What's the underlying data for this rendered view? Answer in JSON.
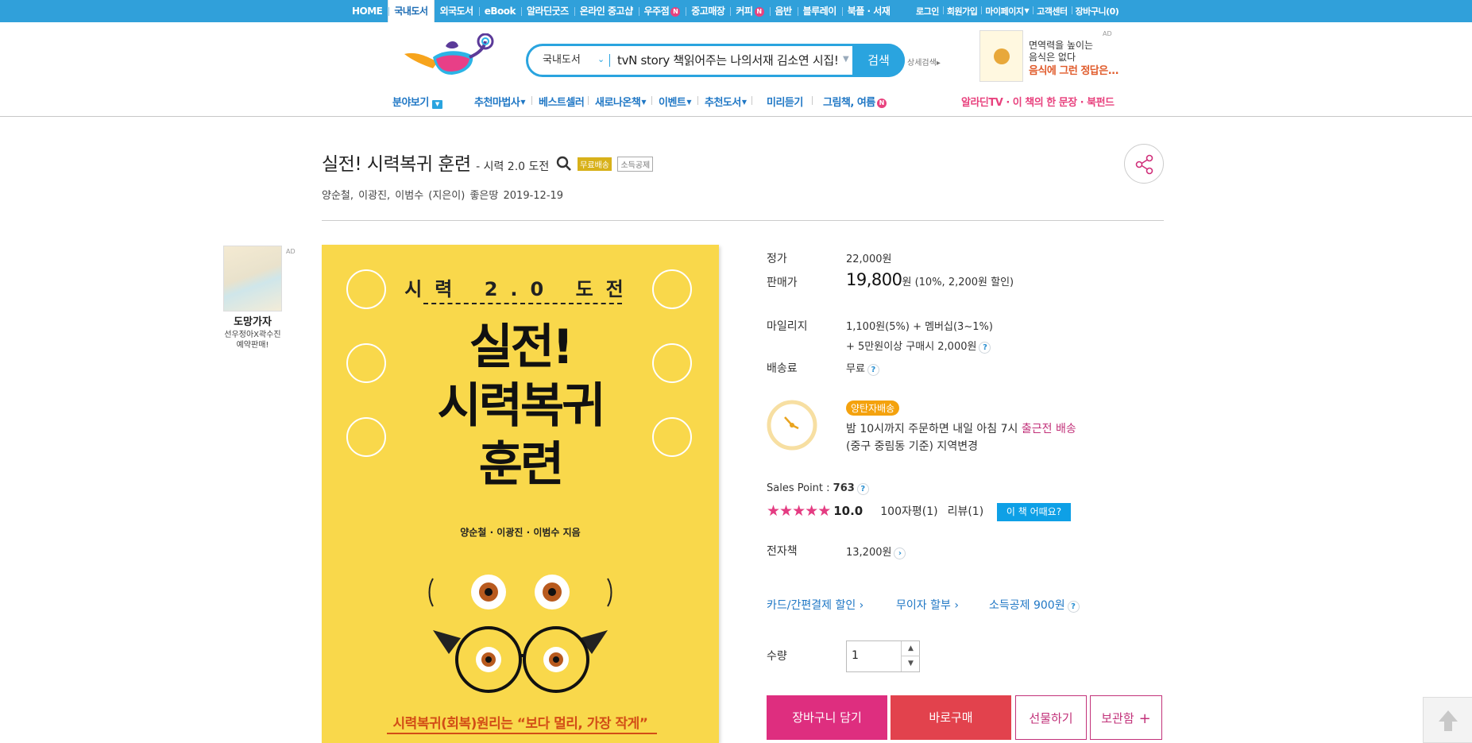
{
  "topnav": {
    "items": [
      "HOME",
      "국내도서",
      "외국도서",
      "eBook",
      "알라딘굿즈",
      "온라인 중고샵",
      "우주점",
      "중고매장",
      "커피",
      "음반",
      "블루레이",
      "북플 · 서재"
    ],
    "active": "국내도서",
    "new_badge": "N",
    "user_links": [
      "로그인",
      "회원가입",
      "마이페이지",
      "고객센터",
      "장바구니(0)"
    ]
  },
  "search": {
    "category": "국내도서",
    "query": "tvN story 책읽어주는 나의서재 김소연 시집!",
    "button": "검색",
    "advanced": "상세검색"
  },
  "top_ad": {
    "line1": "면역력을 높이는",
    "line2": "음식은 없다",
    "line3": "음식에 그런 정답은...",
    "ad_label": "AD"
  },
  "catnav": {
    "browse": "분야보기",
    "items": [
      "추천마법사",
      "베스트셀러",
      "새로나온책",
      "이벤트",
      "추천도서",
      "미리듣기",
      "그림책, 여름"
    ],
    "right": "알라딘TV · 이 책의 한 문장 · 북펀드"
  },
  "book": {
    "title": "실전! 시력복귀 훈련",
    "subtitle": "- 시력 2.0 도전",
    "tags": [
      "무료배송",
      "소득공제"
    ],
    "authors": "양순철,  이광진,  이범수 (지은이)",
    "publisher": "좋은땅",
    "date": "2019-12-19"
  },
  "cover": {
    "top": "시력 2.0 도전",
    "big_lines": [
      "실전!",
      "시력복귀",
      "훈련"
    ],
    "authors": "양순철 · 이광진 · 이범수 지음",
    "tagline": "시력복귀(회복)원리는 “보다 멀리, 가장 작게”"
  },
  "side_ad": {
    "title": "도망가자",
    "line2": "선우정아X곽수진",
    "line3": "예약판매!",
    "ad_label": "AD"
  },
  "info": {
    "price_label": "정가",
    "price": "22,000원",
    "sale_label": "판매가",
    "sale_price": "19,800",
    "sale_unit": "원",
    "sale_detail": "(10%, 2,200원 할인)",
    "mileage_label": "마일리지",
    "mileage1": "1,100원(5%)  + 멤버십(3~1%)",
    "mileage2": "+ 5만원이상 구매시 2,000원",
    "shipping_label": "배송료",
    "shipping": "무료",
    "delivery_badge": "양탄자배송",
    "delivery_text_a": "밤 10시까지 주문하면 내일 아침 7시",
    "delivery_text_b": "출근전 배송",
    "delivery_region": "(중구 중림동 기준) 지역변경",
    "sales_point_label": "Sales Point :",
    "sales_point": "763",
    "rating": "10.0",
    "reviews_100": "100자평(1)",
    "reviews": "리뷰(1)",
    "how_button": "이 책 어때요?",
    "ebook_label": "전자책",
    "ebook_price": "13,200원",
    "links": [
      "카드/간편결제 할인",
      "무이자 할부",
      "소득공제 900원"
    ],
    "qty_label": "수량",
    "qty": "1",
    "help": "?"
  },
  "buttons": {
    "cart": "장바구니 담기",
    "buy": "바로구매",
    "gift": "선물하기",
    "save": "보관함",
    "save_plus": "+"
  },
  "colors": {
    "brand_blue": "#30a0da",
    "pink": "#de2e7f",
    "red": "#e2424d",
    "cover_yellow": "#f9d84b"
  }
}
